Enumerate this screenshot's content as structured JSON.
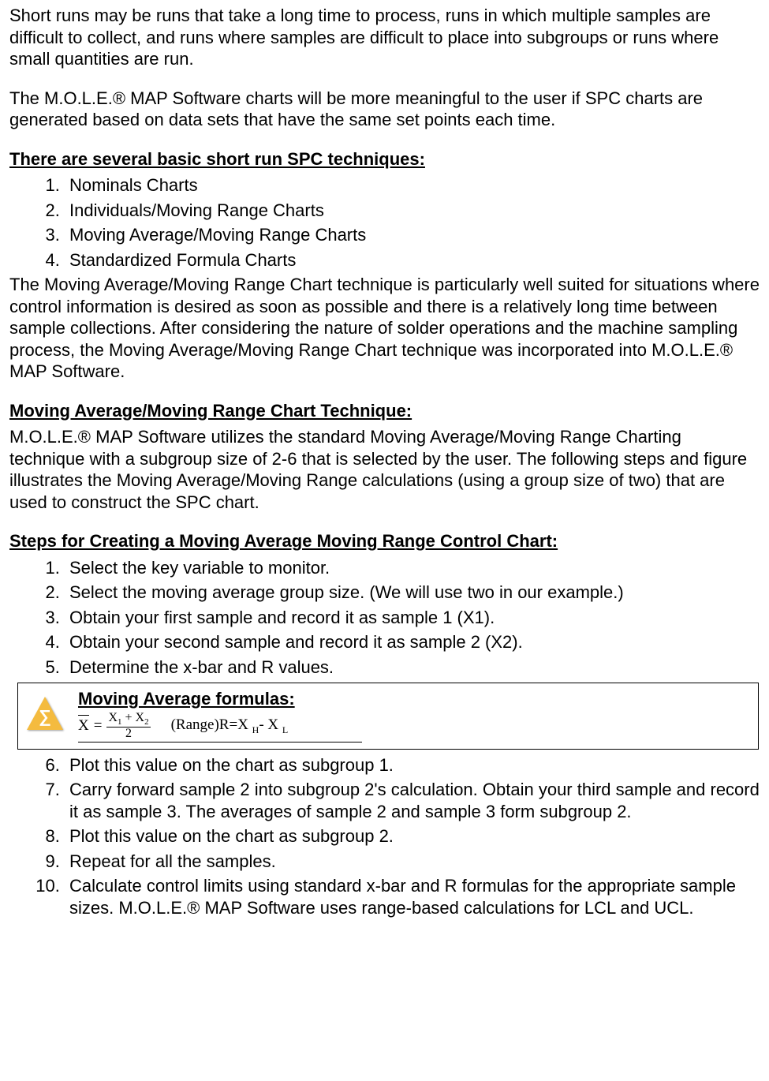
{
  "p_intro1": "Short runs may be runs that take a long time to process, runs in which multiple samples are difficult to collect, and runs where samples are difficult to place into subgroups or runs where small quantities are run.",
  "p_intro2": "The M.O.L.E.® MAP Software charts will be more meaningful to the user if SPC charts are generated based on data sets that have the same set points each time.",
  "h_basic": "There are several basic short run SPC techniques:",
  "basic_list": {
    "i1": "Nominals Charts",
    "i2": "Individuals/Moving Range Charts",
    "i3": "Moving Average/Moving Range Charts",
    "i4": "Standardized Formula Charts"
  },
  "p_basic_follow": "The Moving Average/Moving Range Chart technique is particularly well suited for situations where control information is desired as soon as possible and there is a relatively long time between sample collections. After considering the nature of solder operations and the machine sampling process, the Moving Average/Moving Range Chart technique was incorporated into M.O.L.E.® MAP Software.",
  "h_technique": "Moving Average/Moving Range Chart Technique:",
  "p_technique": "M.O.L.E.® MAP Software utilizes the standard Moving Average/Moving Range Charting technique with a subgroup size of 2-6 that is selected by the user. The following steps and figure illustrates the Moving Average/Moving Range calculations (using a group size of two) that are used to construct the SPC chart.",
  "h_steps": "Steps for Creating a Moving Average Moving Range Control Chart:",
  "steps1": {
    "s1": "Select the key variable to monitor.",
    "s2": "Select the moving average group size. (We will use two in our example.)",
    "s3": "Obtain your first sample and record it as sample 1 (X1).",
    "s4": "Obtain your second sample and record it as sample 2 (X2).",
    "s5": "Determine the x-bar and R values."
  },
  "formula": {
    "title": "Moving Average formulas:",
    "xbar_lhs": "X",
    "eq": "=",
    "numerator_a": "X",
    "sub1": "1",
    "plus": " + ",
    "numerator_b": "X",
    "sub2": "2",
    "denominator": "2",
    "range_label": "(Range)R=X",
    "subH": "H",
    "minus": "- ",
    "x2": "X",
    "subL": "L",
    "sigma": "∑"
  },
  "steps2": {
    "s6": "Plot this value on the chart as subgroup 1.",
    "s7": "Carry forward sample 2 into subgroup 2's calculation. Obtain your third sample and record it as sample 3. The averages of sample 2 and sample 3 form subgroup 2.",
    "s8": "Plot this value on the chart as subgroup 2.",
    "s9": "Repeat for all the samples.",
    "s10": "Calculate control limits using standard x-bar and R formulas for the appropriate sample sizes. M.O.L.E.® MAP Software uses range-based calculations for LCL and UCL."
  }
}
